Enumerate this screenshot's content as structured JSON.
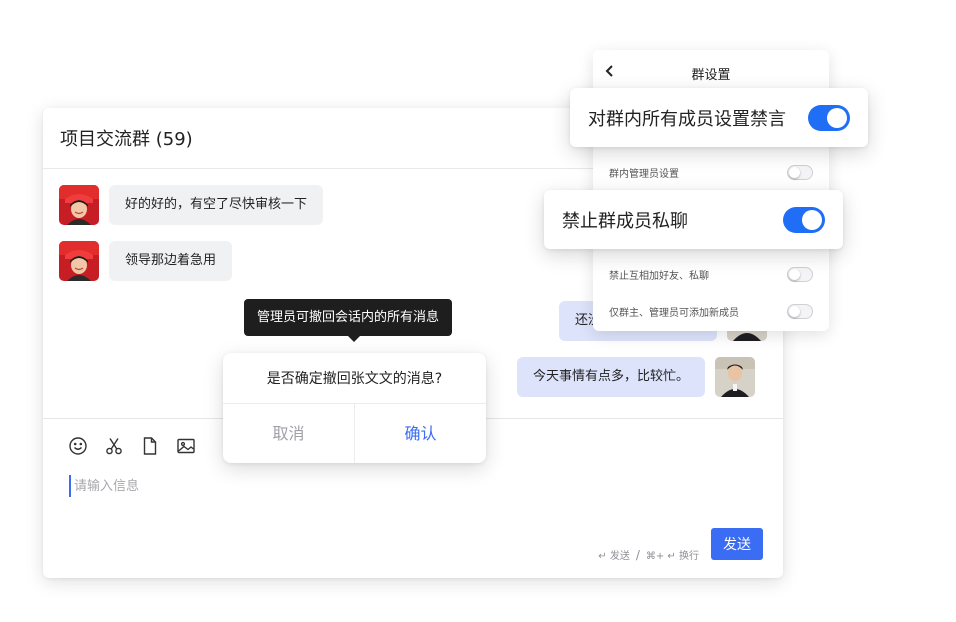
{
  "chat": {
    "title": "项目交流群 (59)",
    "messages": [
      {
        "side": "in",
        "text": "好的好的，有空了尽快审核一下"
      },
      {
        "side": "in",
        "text": "领导那边着急用"
      },
      {
        "side": "out",
        "text": "还没"
      },
      {
        "side": "out",
        "text": "今天事情有点多，比较忙。"
      }
    ],
    "tooltip": "管理员可撤回会话内的所有消息",
    "composer": {
      "placeholder": "请输入信息",
      "hint_send": "↵ 发送",
      "hint_sep": "/",
      "hint_newline": "⌘+ ↵ 换行",
      "send_label": "发送",
      "tools": [
        "smile-icon",
        "scissors-icon",
        "file-icon",
        "image-icon"
      ]
    }
  },
  "dialog": {
    "question": "是否确定撤回张文文的消息?",
    "cancel": "取消",
    "confirm": "确认"
  },
  "settings": {
    "title": "群设置",
    "rows": [
      {
        "label": "群内管理员设置",
        "on": false
      },
      {
        "label": "禁止互相加好友、私聊",
        "on": false
      },
      {
        "label": "仅群主、管理员可添加新成员",
        "on": false
      }
    ]
  },
  "cards": {
    "mute_all": {
      "label": "对群内所有成员设置禁言",
      "on": true
    },
    "no_private": {
      "label": "禁止群成员私聊",
      "on": true
    }
  },
  "colors": {
    "accent": "#3a6cf4",
    "toggle_on": "#1f6ef5",
    "bubble_out": "#dde3fb",
    "bubble_in": "#f0f1f3"
  }
}
